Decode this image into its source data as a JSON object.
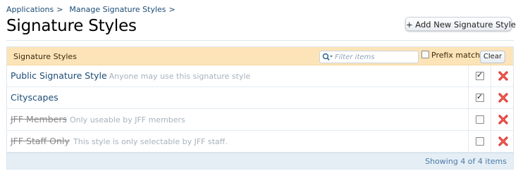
{
  "breadcrumb": [
    {
      "label": "Applications"
    },
    {
      "label": "Manage Signature Styles"
    }
  ],
  "breadcrumb_separator": ">",
  "page_title": "Signature Styles",
  "add_button_label": "+ Add New Signature Style",
  "panel": {
    "title": "Signature Styles",
    "filter_placeholder": "Filter items",
    "filter_value": "",
    "prefix_match_label": "Prefix match",
    "prefix_match_checked": false,
    "clear_label": "Clear"
  },
  "rows": [
    {
      "name": "Public Signature Style",
      "description": "Anyone may use this signature style",
      "enabled": true
    },
    {
      "name": "Cityscapes",
      "description": "",
      "enabled": true
    },
    {
      "name": "JFF Members",
      "description": "Only useable by JFF members",
      "enabled": false
    },
    {
      "name": "JFF Staff Only",
      "description": "This style is only selectable by JFF staff.",
      "enabled": false
    }
  ],
  "footer_text": "Showing 4 of 4 items",
  "colors": {
    "header_bg": "#fde4b8",
    "link": "#1b4c76",
    "delete": "#d9302b",
    "footer_bg": "#e6eef5"
  },
  "icons": {
    "filter": "search-icon",
    "delete": "delete-icon"
  }
}
